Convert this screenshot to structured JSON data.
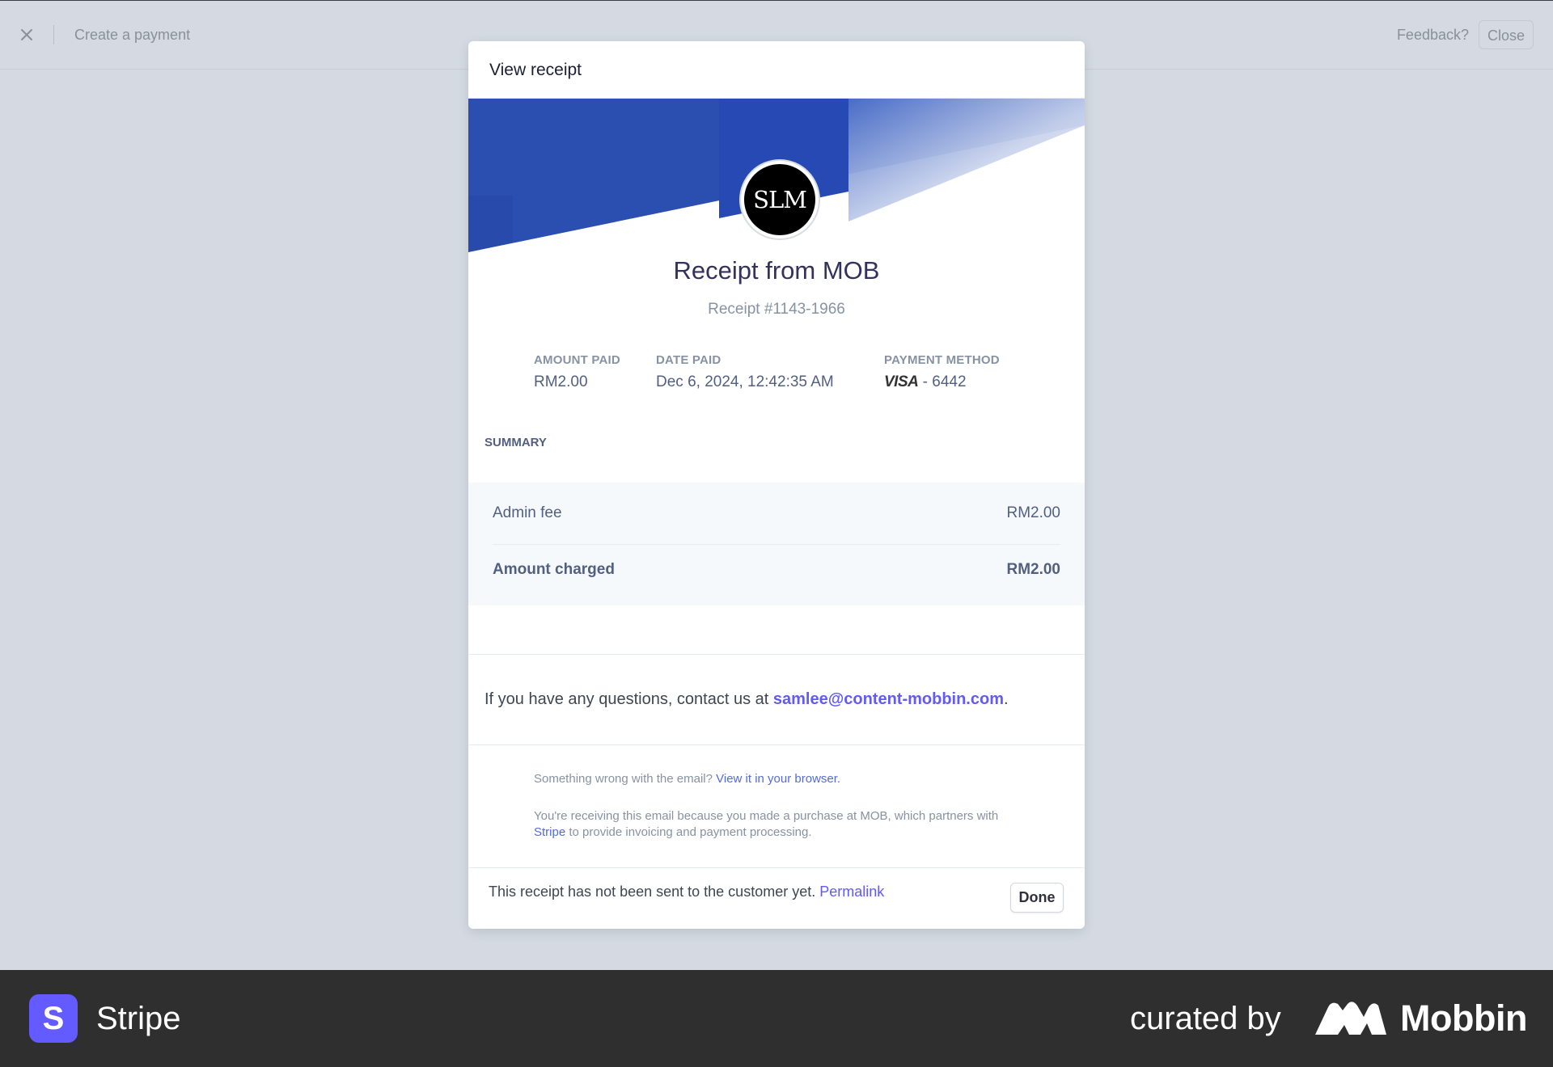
{
  "topbar": {
    "title": "Create a payment",
    "feedback_label": "Feedback?",
    "close_label": "Close"
  },
  "modal": {
    "title": "View receipt",
    "logo_text": "SLM",
    "receipt_title": "Receipt from MOB",
    "receipt_number": "Receipt #1143-1966",
    "info": {
      "amount_paid_label": "AMOUNT PAID",
      "amount_paid_value": "RM2.00",
      "date_paid_label": "DATE PAID",
      "date_paid_value": "Dec 6, 2024, 12:42:35 AM",
      "payment_method_label": "PAYMENT METHOD",
      "card_brand": "VISA",
      "card_last4": "- 6442"
    },
    "summary": {
      "label": "SUMMARY",
      "rows": [
        {
          "label": "Admin fee",
          "amount": "RM2.00"
        },
        {
          "label": "Amount charged",
          "amount": "RM2.00"
        }
      ]
    },
    "contact": {
      "prefix": "If you have any questions, contact us at ",
      "email": "samlee@content-mobbin.com",
      "suffix": "."
    },
    "fine_print": {
      "wrong_email_text": "Something wrong with the email? ",
      "view_in_browser_link": "View it in your browser.",
      "receiving_text_1": "You're receiving this email because you made a purchase at MOB, which partners with ",
      "stripe_link": "Stripe",
      "receiving_text_2": " to provide invoicing and payment processing."
    },
    "footer": {
      "status_text": "This receipt has not been sent to the customer yet. ",
      "permalink_label": "Permalink",
      "done_label": "Done"
    }
  },
  "branding": {
    "app_icon_letter": "S",
    "app_name": "Stripe",
    "curated_by": "curated by",
    "curator_name": "Mobbin"
  },
  "colors": {
    "banner_blue": "#2a4fb0",
    "accent_purple": "#625afa",
    "stripe_purple": "#635bff"
  }
}
